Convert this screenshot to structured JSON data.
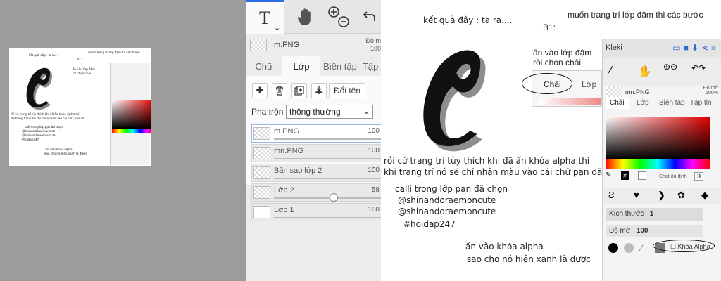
{
  "thumbnail": {
    "lines": [
      "kết quả đây : ta ra...",
      "muốn trang trí lớp đậm thì các bước",
      "B1:",
      "ấn vào lớp đậm",
      "rồi chọn chải",
      "rồi cứ trang trí tùy thích khi đã ấn khóa alpha thì",
      "khi trang trí nó sẽ chỉ nhận màu vào cái chữ pạn đã",
      "calli trong lớp pạn đã chọn",
      "@shinandoraemoncute",
      "@shinandoraemoncute",
      "#hoidap247",
      "ấn vào khóa alpha",
      "sao cho nó hiện xanh là được"
    ]
  },
  "layers_panel": {
    "tool_text": "T",
    "file_name": "m.PNG",
    "opacity_label": "Độ m",
    "opacity_value": "100",
    "tabs": [
      "Chữ",
      "Lớp",
      "Biên tập",
      "Tập"
    ],
    "active_tab": "Lớp",
    "rename_label": "Đổi tên",
    "blend_label": "Pha trộn",
    "blend_value": "thông thường",
    "layers": [
      {
        "name": "m.PNG",
        "opacity": "100",
        "level": 1.0
      },
      {
        "name": "mn.PNG",
        "opacity": "100",
        "level": 1.0
      },
      {
        "name": "Bản sao lớp 2",
        "opacity": "100",
        "level": 1.0
      },
      {
        "name": "Lớp 2",
        "opacity": "58",
        "level": 0.58
      },
      {
        "name": "Lớp 1",
        "opacity": "100",
        "level": 1.0
      }
    ]
  },
  "tutorial": {
    "result_caption": "kết quả đây : ta ra....",
    "steps_caption": "muốn trang trí lớp đậm thì các bước",
    "step_b1": "B1:",
    "press_layer": "ấn vào lớp đậm",
    "choose_brush": "rồi chọn chải",
    "overlay_tab_brush": "Chải",
    "overlay_tab_layer": "Lớp",
    "decorate_line1": "rồi cứ trang trí tùy thích khi đã ấn khóa alpha thì",
    "decorate_line2": "khi trang trí nó sẽ chỉ nhận màu vào cái chữ pạn đã",
    "calli_line": "calli trong lớp pạn đã chọn",
    "credit1": "@shinandoraemoncute",
    "credit2": "@shinandoraemoncute",
    "hashtag": "#hoidap247",
    "alpha_line1": "ấn vào khóa alpha",
    "alpha_line2": "sao cho nó hiện xanh là được"
  },
  "kleki": {
    "logo": "Kleki",
    "file_name": "mn.PNG",
    "opacity_label": "Độ mờ",
    "opacity_value": "100%",
    "tabs": [
      "Chải",
      "Lớp",
      "Biên tập",
      "Tập tin"
    ],
    "stabilizer_label": "Chất ổn định",
    "stabilizer_value": "3",
    "size_label": "Kích thước",
    "size_value": "1",
    "alpha_opacity_label": "Độ mờ",
    "alpha_opacity_value": "100",
    "alpha_lock_label": "Khóa Alpha"
  },
  "colors": {
    "accent": "#2a6ee8",
    "panel": "#ececec"
  }
}
